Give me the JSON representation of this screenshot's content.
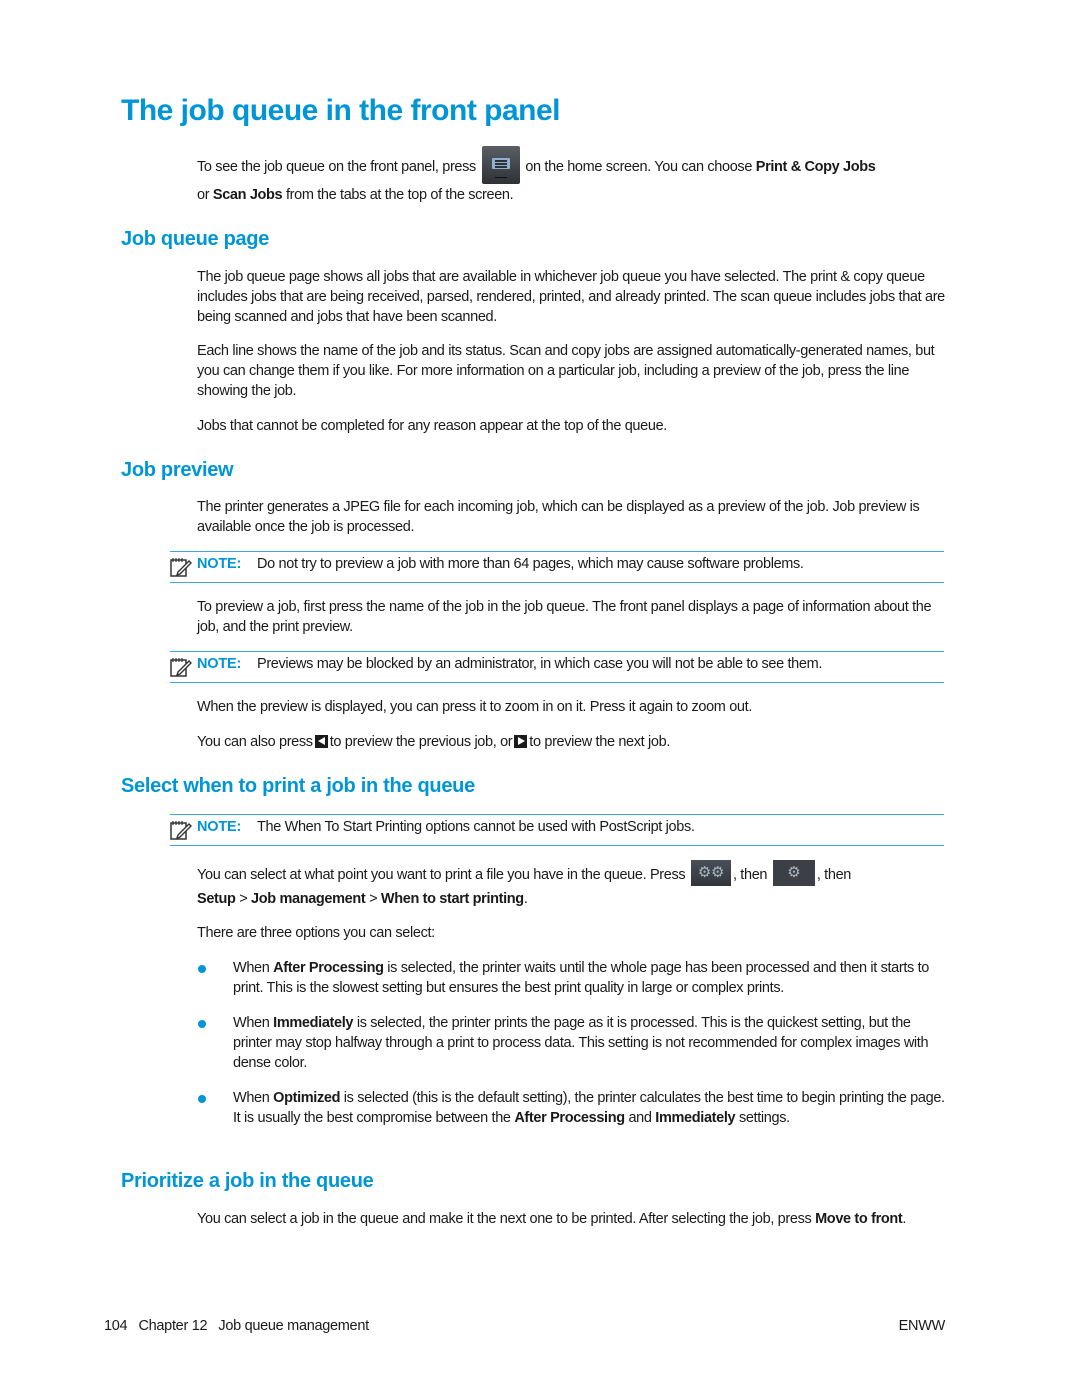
{
  "title": "The job queue in the front panel",
  "intro": {
    "line1_before_icon": "To see the job queue on the front panel, press",
    "icon": "job-queue-icon",
    "line1_after_icon": "on the home screen. You can choose",
    "line1_bold": "Print & Copy Jobs",
    "line2_prefix": "or",
    "line2_bold": "Scan Jobs",
    "line2_suffix": "from the tabs at the top of the screen."
  },
  "sections": {
    "job_queue_page": {
      "heading": "Job queue page",
      "p1": "The job queue page shows all jobs that are available in whichever job queue you have selected. The print & copy queue includes jobs that are being received, parsed, rendered, printed, and already printed. The scan queue includes jobs that are being scanned and jobs that have been scanned.",
      "p2": "Each line shows the name of the job and its status. Scan and copy jobs are assigned automatically-generated names, but you can change them if you like. For more information on a particular job, including a preview of the job, press the line showing the job.",
      "p3": "Jobs that cannot be completed for any reason appear at the top of the queue."
    },
    "job_preview": {
      "heading": "Job preview",
      "p1": "The printer generates a JPEG file for each incoming job, which can be displayed as a preview of the job. Job preview is available once the job is processed.",
      "note1": {
        "label": "NOTE:",
        "text": "Do not try to preview a job with more than 64 pages, which may cause software problems."
      },
      "p2": "To preview a job, first press the name of the job in the job queue. The front panel displays a page of information about the job, and the print preview.",
      "note2": {
        "label": "NOTE:",
        "text": "Previews may be blocked by an administrator, in which case you will not be able to see them."
      },
      "p3": "When the preview is displayed, you can press it to zoom in on it. Press it again to zoom out.",
      "p4_a": "You can also press",
      "p4_icon1": "previous-arrow-icon",
      "p4_b": "to preview the previous job, or",
      "p4_icon2": "next-arrow-icon",
      "p4_c": "to preview the next job."
    },
    "select_when": {
      "heading": "Select when to print a job in the queue",
      "note": {
        "label": "NOTE:",
        "text": "The When To Start Printing options cannot be used with PostScript jobs."
      },
      "p1_a": "You can select at what point you want to print a file you have in the queue. Press",
      "p1_icon1": "settings-gears-icon",
      "p1_b": ", then",
      "p1_icon2": "setup-gear-icon",
      "p1_c": ", then",
      "path": [
        "Setup",
        "Job management",
        "When to start printing"
      ],
      "path_sep": ">",
      "path_end": ".",
      "p2": "There are three options you can select:",
      "bullets": [
        {
          "pre": "When",
          "bold": "After Processing",
          "post": "is selected, the printer waits until the whole page has been processed and then it starts to print. This is the slowest setting but ensures the best print quality in large or complex prints."
        },
        {
          "pre": "When",
          "bold": "Immediately",
          "post": "is selected, the printer prints the page as it is processed. This is the quickest setting, but the printer may stop halfway through a print to process data. This setting is not recommended for complex images with dense color."
        },
        {
          "pre": "When",
          "bold": "Optimized",
          "post": "is selected (this is the default setting), the printer calculates the best time to begin printing the page. It is usually the best compromise between the",
          "bold2": "After Processing",
          "mid": "and",
          "bold3": "Immediately",
          "end": "settings."
        }
      ]
    },
    "prioritize": {
      "heading": "Prioritize a job in the queue",
      "p1": "You can select a job in the queue and make it the next one to be printed. After selecting the job, press",
      "p1_bold": "Move to front",
      "p1_end": "."
    }
  },
  "footer": {
    "page_number": "104",
    "chapter": "Chapter 12",
    "chapter_title": "Job queue management",
    "right": "ENWW"
  },
  "colors": {
    "accent": "#0096d6",
    "text": "#1a1a1a",
    "rule": "#3aa8dc"
  }
}
